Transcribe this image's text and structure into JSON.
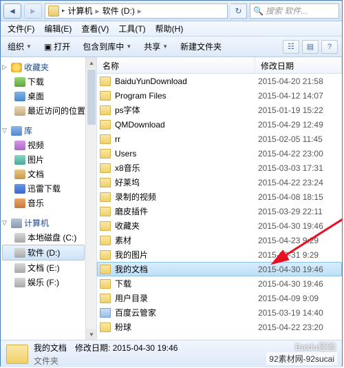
{
  "breadcrumb": {
    "parts": [
      "计算机",
      "软件 (D:)"
    ]
  },
  "search": {
    "placeholder": "搜索 软件..."
  },
  "menu": {
    "file": "文件(F)",
    "edit": "编辑(E)",
    "view": "查看(V)",
    "tools": "工具(T)",
    "help": "帮助(H)"
  },
  "toolbar": {
    "organize": "组织",
    "open": "打开",
    "include": "包含到库中",
    "share": "共享",
    "newfolder": "新建文件夹"
  },
  "columns": {
    "name": "名称",
    "date": "修改日期"
  },
  "sidebar": {
    "favorites": {
      "label": "收藏夹",
      "items": [
        {
          "label": "下载",
          "cls": "dl"
        },
        {
          "label": "桌面",
          "cls": "desk"
        },
        {
          "label": "最近访问的位置",
          "cls": "recent"
        }
      ]
    },
    "libraries": {
      "label": "库",
      "items": [
        {
          "label": "视频",
          "cls": "vid"
        },
        {
          "label": "图片",
          "cls": "pic"
        },
        {
          "label": "文档",
          "cls": "doc"
        },
        {
          "label": "迅雷下载",
          "cls": "xl"
        },
        {
          "label": "音乐",
          "cls": "mus"
        }
      ]
    },
    "computer": {
      "label": "计算机",
      "items": [
        {
          "label": "本地磁盘 (C:)",
          "cls": "drv",
          "sel": false
        },
        {
          "label": "软件 (D:)",
          "cls": "drv",
          "sel": true
        },
        {
          "label": "文档 (E:)",
          "cls": "drv",
          "sel": false
        },
        {
          "label": "娱乐 (F:)",
          "cls": "drv",
          "sel": false
        }
      ]
    }
  },
  "files": [
    {
      "name": "BaiduYunDownload",
      "date": "2015-04-20 21:58",
      "t": "f"
    },
    {
      "name": "Program Files",
      "date": "2015-04-12 14:07",
      "t": "f"
    },
    {
      "name": "ps字体",
      "date": "2015-01-19 15:22",
      "t": "f"
    },
    {
      "name": "QMDownload",
      "date": "2015-04-29 12:49",
      "t": "f"
    },
    {
      "name": "rr",
      "date": "2015-02-05 11:45",
      "t": "f"
    },
    {
      "name": "Users",
      "date": "2015-04-22 23:00",
      "t": "f"
    },
    {
      "name": "x8音乐",
      "date": "2015-03-03 17:31",
      "t": "f"
    },
    {
      "name": "好莱坞",
      "date": "2015-04-22 23:24",
      "t": "f"
    },
    {
      "name": "录制的视频",
      "date": "2015-04-08 18:15",
      "t": "f"
    },
    {
      "name": "磨皮插件",
      "date": "2015-03-29 22:11",
      "t": "f"
    },
    {
      "name": "收藏夹",
      "date": "2015-04-30 19:46",
      "t": "f"
    },
    {
      "name": "素材",
      "date": "2015-04-23 9:29",
      "t": "f"
    },
    {
      "name": "我的图片",
      "date": "2015-03-31 9:29",
      "t": "f"
    },
    {
      "name": "我的文档",
      "date": "2015-04-30 19:46",
      "t": "f",
      "sel": true
    },
    {
      "name": "下载",
      "date": "2015-04-30 19:46",
      "t": "f"
    },
    {
      "name": "用户目录",
      "date": "2015-04-09 9:09",
      "t": "f"
    },
    {
      "name": "百度云管家",
      "date": "2015-03-19 14:40",
      "t": "a"
    },
    {
      "name": "粉球",
      "date": "2015-04-22 23:20",
      "t": "f"
    }
  ],
  "status": {
    "name": "我的文档",
    "modlabel": "修改日期:",
    "moddate": "2015-04-30 19:46",
    "type": "文件夹"
  },
  "watermark": {
    "a": "Baidu经验",
    "b": "92素材网-92sucai"
  }
}
